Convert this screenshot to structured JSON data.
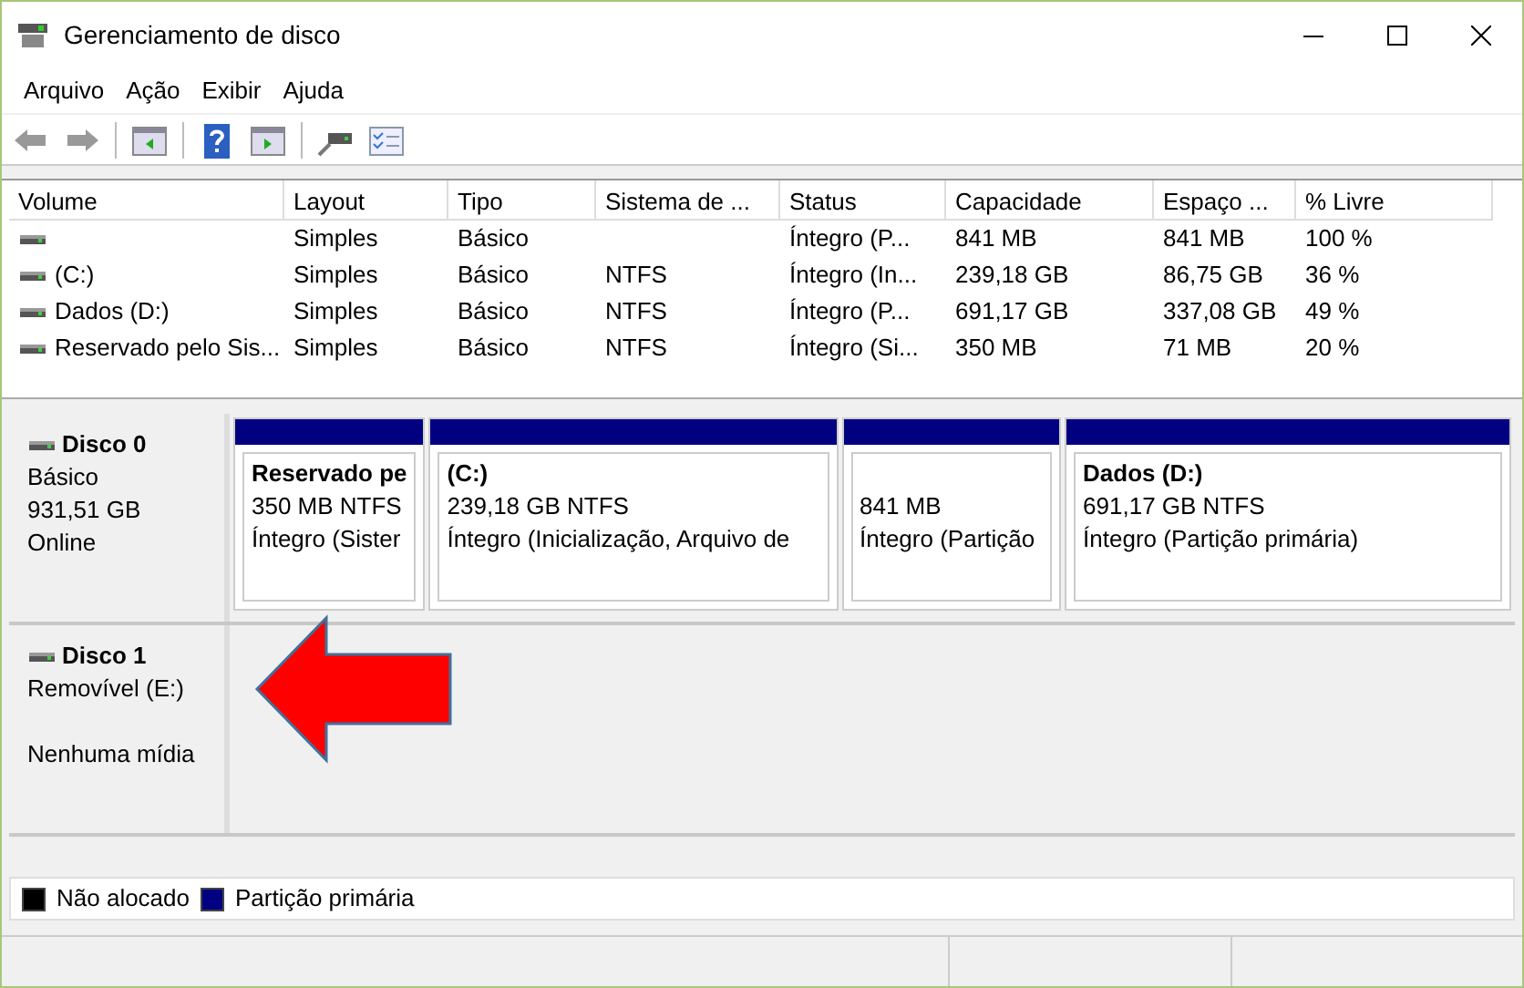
{
  "window": {
    "title": "Gerenciamento de disco"
  },
  "menu": [
    "Arquivo",
    "Ação",
    "Exibir",
    "Ajuda"
  ],
  "toolbar": [
    {
      "kind": "back",
      "disabled": true
    },
    {
      "kind": "forward",
      "disabled": true
    },
    {
      "kind": "sep"
    },
    {
      "kind": "pane-left"
    },
    {
      "kind": "sep"
    },
    {
      "kind": "help"
    },
    {
      "kind": "pane-right"
    },
    {
      "kind": "sep"
    },
    {
      "kind": "connect"
    },
    {
      "kind": "checklist"
    }
  ],
  "table": {
    "columns": [
      "Volume",
      "Layout",
      "Tipo",
      "Sistema de ...",
      "Status",
      "Capacidade",
      "Espaço ...",
      "% Livre"
    ],
    "rows": [
      [
        "",
        "Simples",
        "Básico",
        "",
        "Íntegro (P...",
        "841 MB",
        "841 MB",
        "100 %"
      ],
      [
        "(C:)",
        "Simples",
        "Básico",
        "NTFS",
        "Íntegro (In...",
        "239,18 GB",
        "86,75 GB",
        "36 %"
      ],
      [
        "Dados (D:)",
        "Simples",
        "Básico",
        "NTFS",
        "Íntegro (P...",
        "691,17 GB",
        "337,08 GB",
        "49 %"
      ],
      [
        "Reservado pelo Sis...",
        "Simples",
        "Básico",
        "NTFS",
        "Íntegro (Si...",
        "350 MB",
        "71 MB",
        "20 %"
      ]
    ]
  },
  "disks": [
    {
      "name": "Disco 0",
      "details": [
        "Básico",
        "931,51 GB"
      ],
      "status": "Online",
      "partitions": [
        {
          "label": "Reservado pe",
          "size": "350 MB NTFS",
          "status": "Íntegro (Sister",
          "color": "#000080"
        },
        {
          "label": "(C:)",
          "size": "239,18 GB NTFS",
          "status": "Íntegro (Inicialização, Arquivo de",
          "color": "#000080"
        },
        {
          "size": "841 MB",
          "status": "Íntegro (Partição",
          "color": "#000080"
        },
        {
          "label": "Dados  (D:)",
          "size": "691,17 GB NTFS",
          "status": "Íntegro (Partição primária)",
          "color": "#000080"
        }
      ]
    },
    {
      "name": "Disco 1",
      "details": [
        "Removível (E:)"
      ],
      "status": "Nenhuma mídia"
    }
  ],
  "legend": [
    {
      "label": "Não alocado",
      "color": "#000000"
    },
    {
      "label": "Partição primária",
      "color": "#000080"
    }
  ]
}
